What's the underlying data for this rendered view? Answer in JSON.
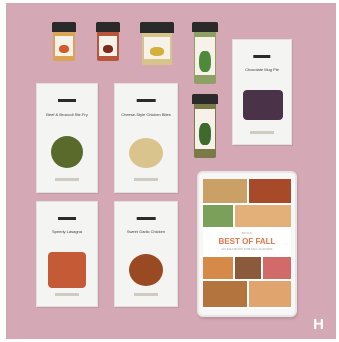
{
  "panel": {
    "background_color": "#d4a8b4",
    "corner_letter": "H"
  },
  "jars": [
    {
      "color": "#d9a456",
      "art_color": "#d35a2a"
    },
    {
      "color": "#b9553a",
      "art_color": "#7b2a1c"
    },
    {
      "color": "#d7c48a",
      "art_color": "#d2b03a"
    },
    {
      "color": "#8fa064",
      "art_color": "#4f8a3a"
    },
    {
      "color": "#7a7a48",
      "art_color": "#3e6a2e"
    }
  ],
  "bags": [
    {
      "title": "Beef & Broccoli Stir-Fry",
      "dish_color": "#5a6a2a"
    },
    {
      "title": "Cheese-Style Chicken Bites",
      "dish_color": "#d8c48c"
    },
    {
      "title": "Chocolate Mug Pie",
      "dish_color": "#4a3248"
    },
    {
      "title": "Speedy Lasagna",
      "dish_color": "#c45a36"
    },
    {
      "title": "Sweet Garlic Chicken",
      "dish_color": "#9a4a22"
    }
  ],
  "ebook": {
    "brand": "BOOK",
    "title": "BEST OF FALL",
    "subtitle": "AN IDEA BOOK FOR FALL FLAVORS"
  }
}
